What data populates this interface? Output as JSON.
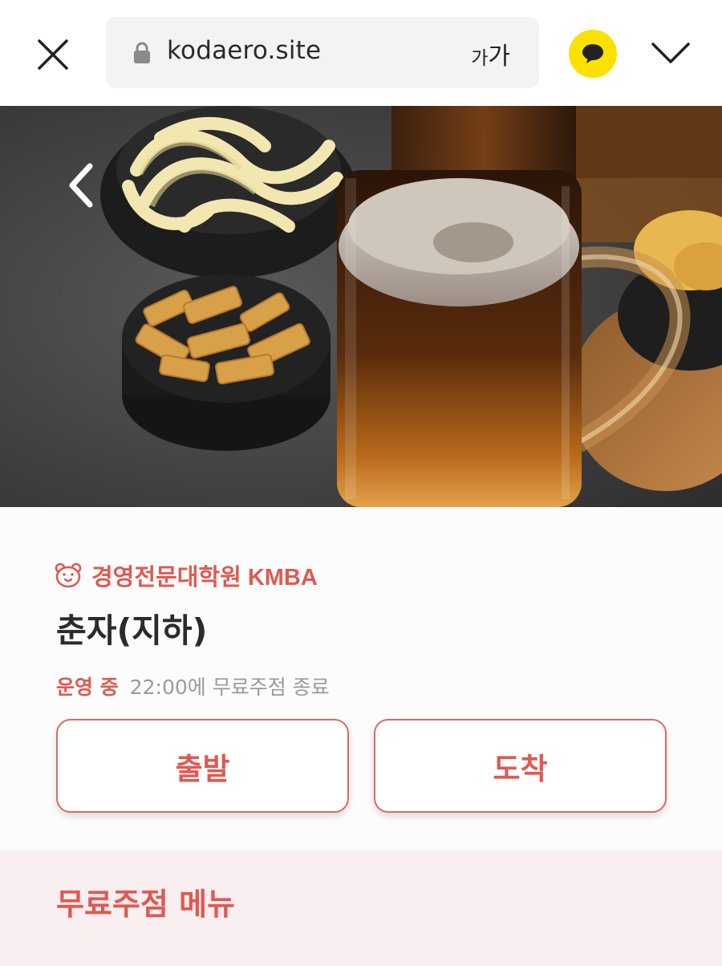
{
  "browser": {
    "url": "kodaero.site",
    "text_size_small": "가",
    "text_size_large": "가",
    "icons": {
      "close": "close-icon",
      "lock": "lock-icon",
      "talk": "speech-bubble-icon",
      "more": "chevron-down-icon"
    },
    "talk_color": "#fae100"
  },
  "hero": {
    "description_icon": "back-arrow-icon"
  },
  "info": {
    "org_icon": "bear-face-icon",
    "org_name": "경영전문대학원 KMBA",
    "place_name": "춘자(지하)",
    "status_open": "운영 중",
    "status_hours": "22:00에 무료주점 종료",
    "depart_label": "출발",
    "arrive_label": "도착",
    "accent_color": "#de5a52"
  },
  "menu": {
    "title": "무료주점 메뉴"
  }
}
